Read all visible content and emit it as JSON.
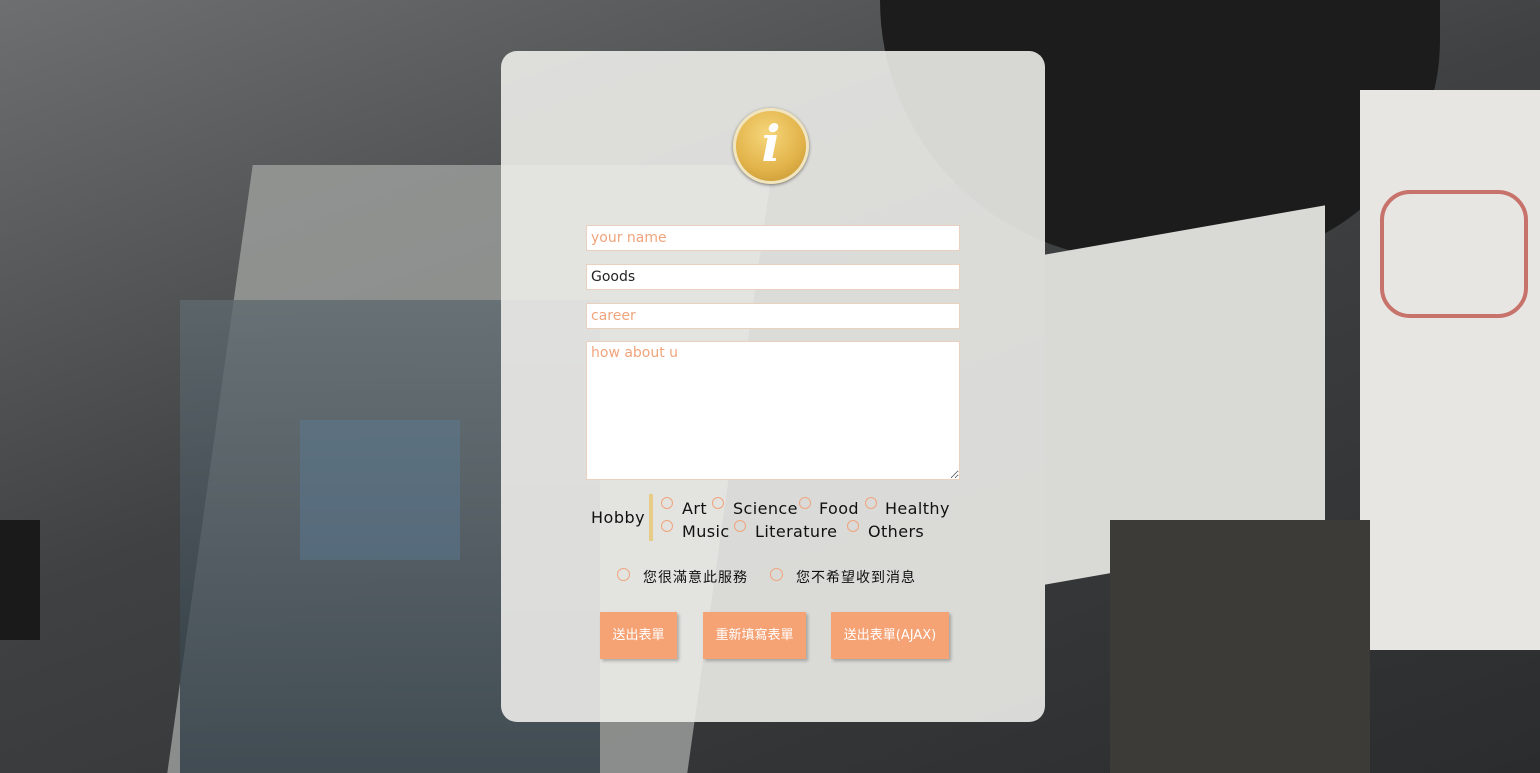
{
  "form": {
    "name_placeholder": "your name",
    "goods_value": "Goods",
    "career_placeholder": "career",
    "about_placeholder": "how about u"
  },
  "hobby": {
    "label": "Hobby",
    "options": [
      "Art",
      "Science",
      "Food",
      "Healthy",
      "Music",
      "Literature",
      "Others"
    ]
  },
  "checks": {
    "satisfied": "您很滿意此服務",
    "no_messages": "您不希望收到消息"
  },
  "buttons": {
    "submit": "送出表單",
    "reset": "重新填寫表單",
    "submit_ajax": "送出表單(AJAX)"
  },
  "icons": {
    "info": "info-icon"
  },
  "colors": {
    "accent": "#f5a274",
    "placeholder": "#f0a47c",
    "hobby_bar": "#e6cc86"
  }
}
